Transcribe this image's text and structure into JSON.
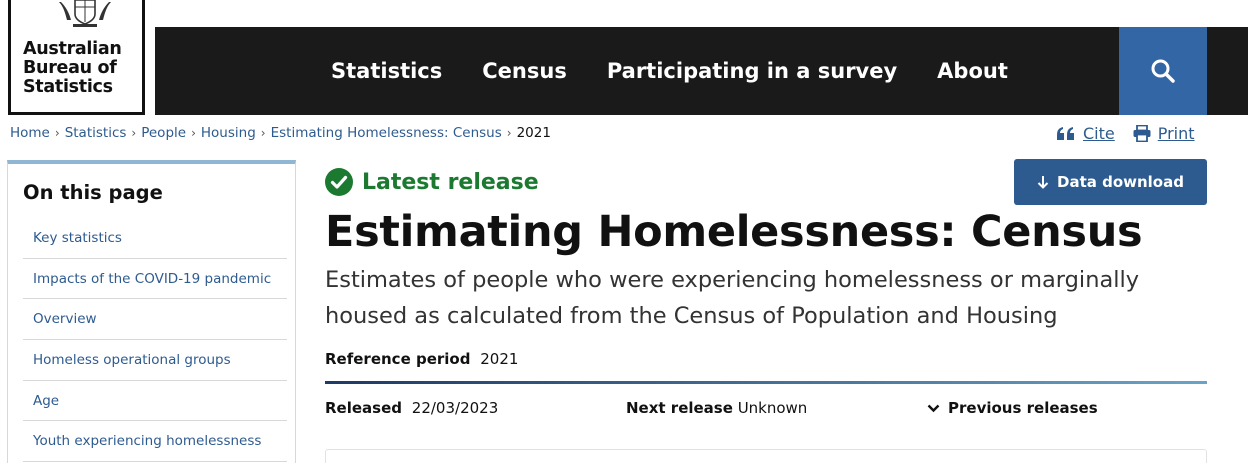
{
  "header": {
    "logo_lines": [
      "Australian",
      "Bureau of",
      "Statistics"
    ],
    "nav": [
      "Statistics",
      "Census",
      "Participating in a survey",
      "About"
    ],
    "search_icon": "search-icon"
  },
  "breadcrumb": {
    "items": [
      "Home",
      "Statistics",
      "People",
      "Housing",
      "Estimating Homelessness: Census"
    ],
    "current": "2021"
  },
  "tools": {
    "cite": "Cite",
    "print": "Print"
  },
  "sidebar": {
    "title": "On this page",
    "items": [
      "Key statistics",
      "Impacts of the COVID-19 pandemic",
      "Overview",
      "Homeless operational groups",
      "Age",
      "Youth experiencing homelessness"
    ]
  },
  "release": {
    "badge": "Latest release",
    "download": "Data download",
    "title": "Estimating Homelessness: Census",
    "subtitle": "Estimates of people who were experiencing homelessness or marginally housed as calculated from the Census of Population and Housing",
    "reference_label": "Reference period",
    "reference_value": "2021",
    "released_label": "Released",
    "released_value": "22/03/2023",
    "next_label": "Next release",
    "next_value": "Unknown",
    "previous": "Previous releases"
  },
  "colors": {
    "nav_bg": "#1a1a1a",
    "search_bg": "#3366a4",
    "link": "#2e5b8f",
    "success": "#1b7a30",
    "button": "#2e5b8f"
  }
}
